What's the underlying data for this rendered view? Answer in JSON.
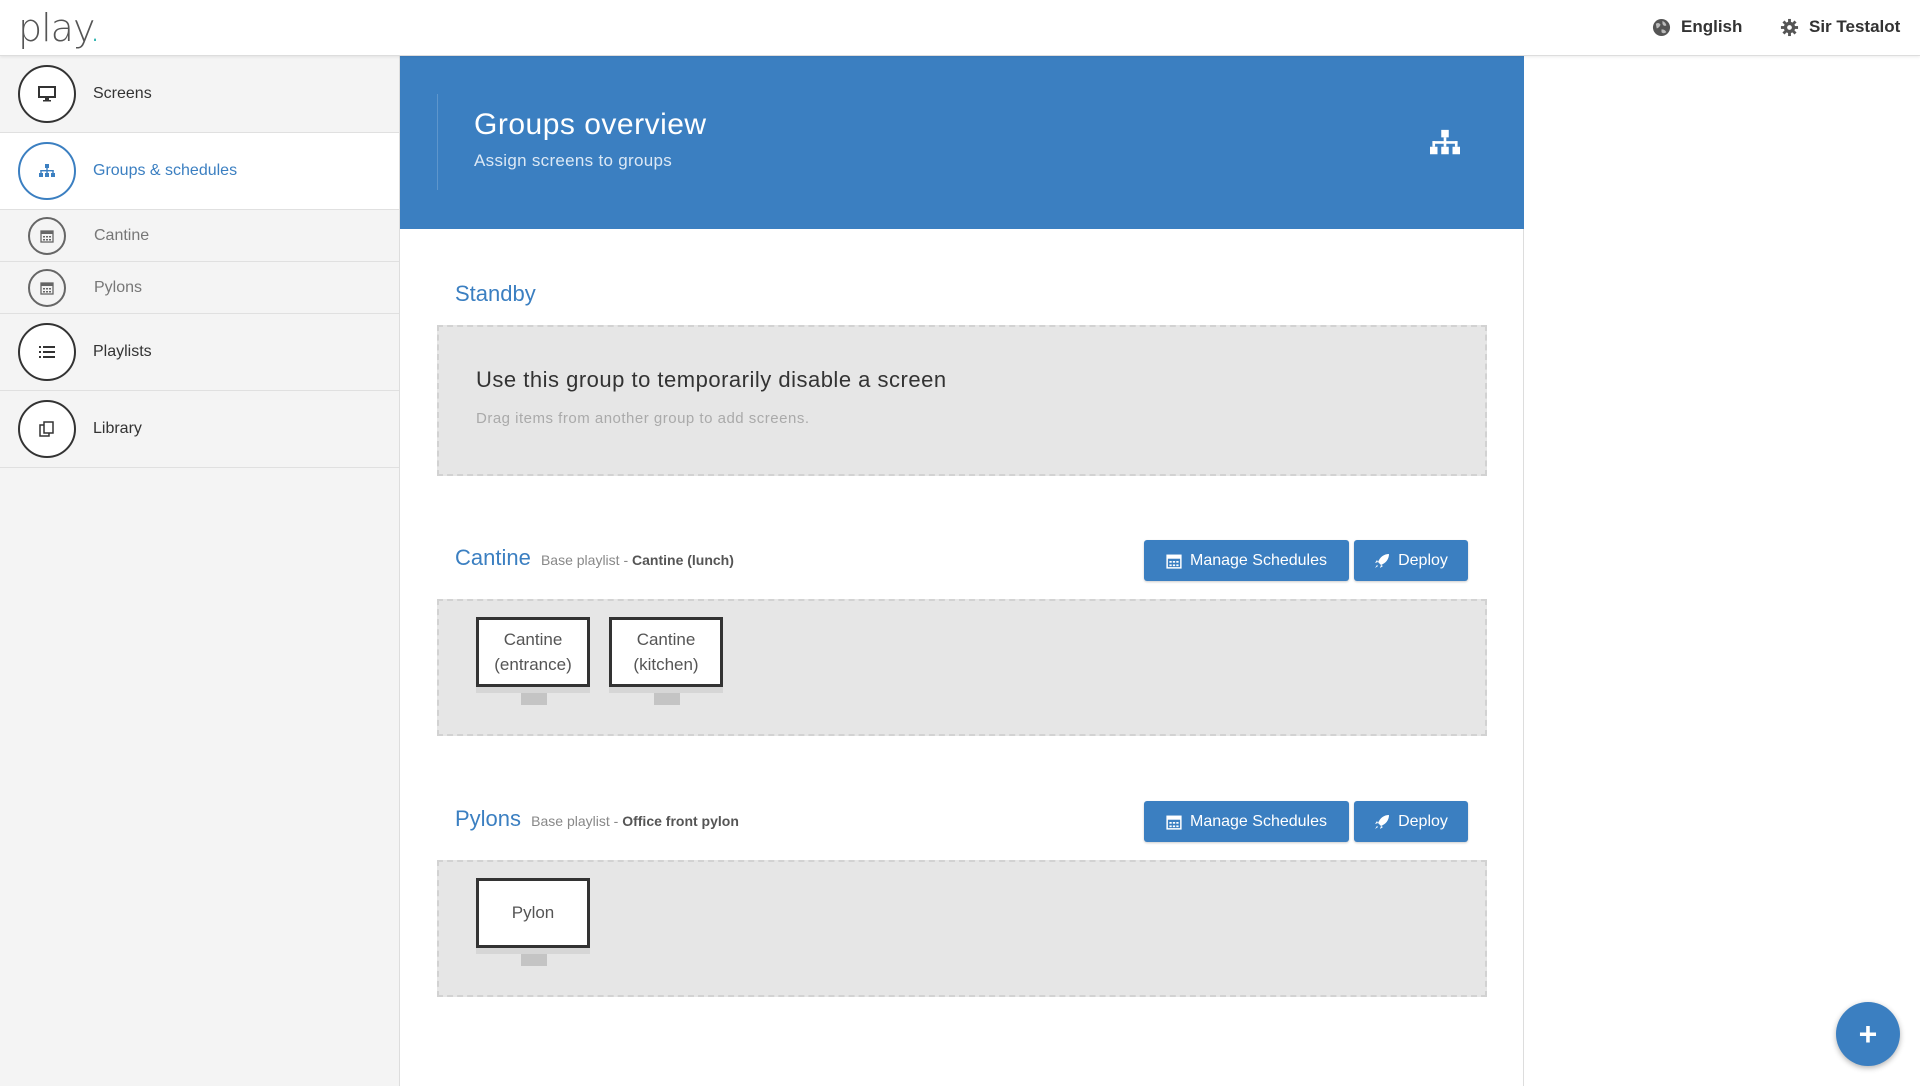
{
  "app": {
    "logo_text": "play",
    "logo_dot": ".",
    "accent_color": "#3b7fc1"
  },
  "topbar": {
    "language": "English",
    "user": "Sir Testalot"
  },
  "sidebar": {
    "items": [
      {
        "label": "Screens",
        "icon": "monitor-icon"
      },
      {
        "label": "Groups & schedules",
        "icon": "sitemap-icon"
      },
      {
        "label": "Playlists",
        "icon": "list-icon"
      },
      {
        "label": "Library",
        "icon": "copy-icon"
      }
    ],
    "subitems": [
      {
        "label": "Cantine",
        "icon": "calendar-icon"
      },
      {
        "label": "Pylons",
        "icon": "calendar-icon"
      }
    ]
  },
  "header": {
    "title": "Groups overview",
    "subtitle": "Assign screens to groups",
    "icon": "sitemap-icon"
  },
  "standby": {
    "title": "Standby",
    "zone_title": "Use this group to temporarily disable a screen",
    "zone_subtitle": "Drag items from another group to add screens."
  },
  "groups": [
    {
      "name": "Cantine",
      "base_label": "Base playlist -",
      "base_playlist": "Cantine (lunch)",
      "manage_label": "Manage Schedules",
      "deploy_label": "Deploy",
      "screens": [
        {
          "line1": "Cantine",
          "line2": "(entrance)"
        },
        {
          "line1": "Cantine",
          "line2": "(kitchen)"
        }
      ]
    },
    {
      "name": "Pylons",
      "base_label": "Base playlist -",
      "base_playlist": "Office front pylon",
      "manage_label": "Manage Schedules",
      "deploy_label": "Deploy",
      "screens": [
        {
          "line1": "Pylon",
          "line2": ""
        }
      ]
    }
  ],
  "fab": {
    "label": "+"
  }
}
